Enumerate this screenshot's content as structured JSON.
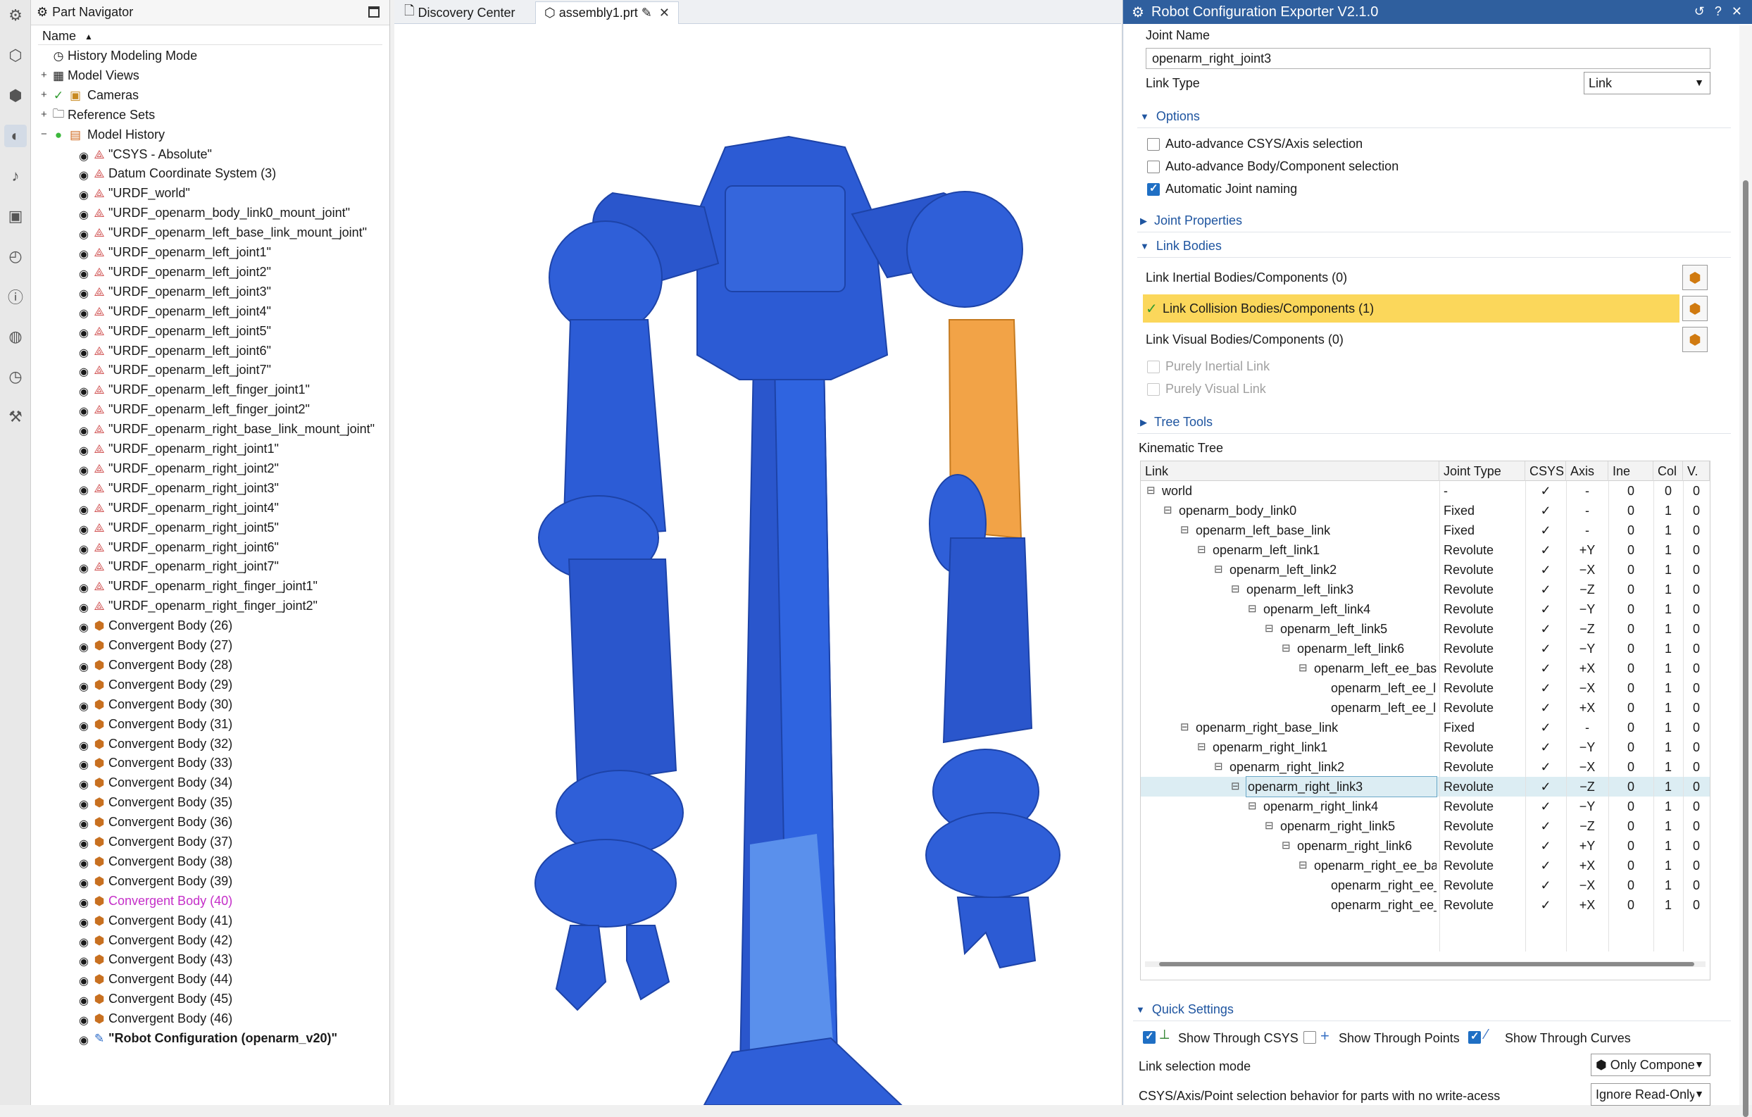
{
  "rail_icons": [
    "gear-icon",
    "part-icon",
    "assembly-icon",
    "navigator-icon",
    "bell-icon",
    "cube-icon",
    "history-icon",
    "info-icon",
    "globe-icon",
    "clock-icon",
    "tools-icon"
  ],
  "navigator": {
    "title": "Part Navigator",
    "column": "Name",
    "rows": [
      {
        "label": "History Modeling Mode",
        "icon": "clock-icon",
        "kind": "mode"
      },
      {
        "label": "Model Views",
        "icon": "views-icon",
        "kind": "folder"
      },
      {
        "label": "Cameras",
        "icon": "camera-icon",
        "kind": "folder"
      },
      {
        "label": "Reference Sets",
        "icon": "folder-icon",
        "kind": "folder"
      },
      {
        "label": "Model History",
        "icon": "history-icon",
        "kind": "folder"
      },
      {
        "label": "\"CSYS - Absolute\"",
        "kind": "csys"
      },
      {
        "label": "Datum Coordinate System (3)",
        "kind": "csys"
      },
      {
        "label": "\"URDF_world\"",
        "kind": "csys"
      },
      {
        "label": "\"URDF_openarm_body_link0_mount_joint\"",
        "kind": "csys"
      },
      {
        "label": "\"URDF_openarm_left_base_link_mount_joint\"",
        "kind": "csys"
      },
      {
        "label": "\"URDF_openarm_left_joint1\"",
        "kind": "csys"
      },
      {
        "label": "\"URDF_openarm_left_joint2\"",
        "kind": "csys"
      },
      {
        "label": "\"URDF_openarm_left_joint3\"",
        "kind": "csys"
      },
      {
        "label": "\"URDF_openarm_left_joint4\"",
        "kind": "csys"
      },
      {
        "label": "\"URDF_openarm_left_joint5\"",
        "kind": "csys"
      },
      {
        "label": "\"URDF_openarm_left_joint6\"",
        "kind": "csys"
      },
      {
        "label": "\"URDF_openarm_left_joint7\"",
        "kind": "csys"
      },
      {
        "label": "\"URDF_openarm_left_finger_joint1\"",
        "kind": "csys"
      },
      {
        "label": "\"URDF_openarm_left_finger_joint2\"",
        "kind": "csys"
      },
      {
        "label": "\"URDF_openarm_right_base_link_mount_joint\"",
        "kind": "csys"
      },
      {
        "label": "\"URDF_openarm_right_joint1\"",
        "kind": "csys"
      },
      {
        "label": "\"URDF_openarm_right_joint2\"",
        "kind": "csys"
      },
      {
        "label": "\"URDF_openarm_right_joint3\"",
        "kind": "csys"
      },
      {
        "label": "\"URDF_openarm_right_joint4\"",
        "kind": "csys"
      },
      {
        "label": "\"URDF_openarm_right_joint5\"",
        "kind": "csys"
      },
      {
        "label": "\"URDF_openarm_right_joint6\"",
        "kind": "csys"
      },
      {
        "label": "\"URDF_openarm_right_joint7\"",
        "kind": "csys"
      },
      {
        "label": "\"URDF_openarm_right_finger_joint1\"",
        "kind": "csys"
      },
      {
        "label": "\"URDF_openarm_right_finger_joint2\"",
        "kind": "csys"
      },
      {
        "label": "Convergent Body (26)",
        "kind": "body"
      },
      {
        "label": "Convergent Body (27)",
        "kind": "body"
      },
      {
        "label": "Convergent Body (28)",
        "kind": "body"
      },
      {
        "label": "Convergent Body (29)",
        "kind": "body"
      },
      {
        "label": "Convergent Body (30)",
        "kind": "body"
      },
      {
        "label": "Convergent Body (31)",
        "kind": "body"
      },
      {
        "label": "Convergent Body (32)",
        "kind": "body"
      },
      {
        "label": "Convergent Body (33)",
        "kind": "body"
      },
      {
        "label": "Convergent Body (34)",
        "kind": "body"
      },
      {
        "label": "Convergent Body (35)",
        "kind": "body"
      },
      {
        "label": "Convergent Body (36)",
        "kind": "body"
      },
      {
        "label": "Convergent Body (37)",
        "kind": "body"
      },
      {
        "label": "Convergent Body (38)",
        "kind": "body"
      },
      {
        "label": "Convergent Body (39)",
        "kind": "body"
      },
      {
        "label": "Convergent Body (40)",
        "kind": "body",
        "highlight": true
      },
      {
        "label": "Convergent Body (41)",
        "kind": "body"
      },
      {
        "label": "Convergent Body (42)",
        "kind": "body"
      },
      {
        "label": "Convergent Body (43)",
        "kind": "body"
      },
      {
        "label": "Convergent Body (44)",
        "kind": "body"
      },
      {
        "label": "Convergent Body (45)",
        "kind": "body"
      },
      {
        "label": "Convergent Body (46)",
        "kind": "body"
      },
      {
        "label": "\"Robot Configuration (openarm_v20)\"",
        "kind": "config",
        "bold": true
      }
    ]
  },
  "tabs": [
    {
      "label": "Discovery Center",
      "icon": "document-icon"
    },
    {
      "label": "assembly1.prt",
      "icon": "part-icon",
      "active": true
    }
  ],
  "colors": {
    "robot": "#2f5fd8",
    "robot_dark": "#1f45b0",
    "robot_light": "#4a7be8",
    "selected": "#f2a347",
    "title_bar": "#2f5f9e",
    "highlight_row": "#fbd75b"
  },
  "dialog": {
    "title": "Robot Configuration Exporter V2.1.0",
    "joint_name_label": "Joint Name",
    "joint_name_value": "openarm_right_joint3",
    "link_type_label": "Link Type",
    "link_type_value": "Link",
    "options_title": "Options",
    "options": [
      {
        "label": "Auto-advance CSYS/Axis selection",
        "checked": false
      },
      {
        "label": "Auto-advance Body/Component selection",
        "checked": false
      },
      {
        "label": "Automatic Joint naming",
        "checked": true
      }
    ],
    "joint_properties_title": "Joint Properties",
    "link_bodies_title": "Link Bodies",
    "inertial_label": "Link Inertial Bodies/Components (0)",
    "collision_label": "Link Collision Bodies/Components (1)",
    "visual_label": "Link Visual Bodies/Components (0)",
    "purely_inertial": "Purely Inertial Link",
    "purely_visual": "Purely Visual Link",
    "tree_tools_title": "Tree Tools",
    "kinematic_tree_label": "Kinematic Tree",
    "columns": [
      "Link",
      "Joint Type",
      "CSYS",
      "Axis",
      "Ine",
      "Col",
      "V."
    ],
    "rows": [
      {
        "name": "world",
        "depth": 0,
        "exp": true,
        "type": "-",
        "csys": "✓",
        "axis": "-",
        "ine": "0",
        "col": "0",
        "v": "0"
      },
      {
        "name": "openarm_body_link0",
        "depth": 1,
        "exp": true,
        "type": "Fixed",
        "csys": "✓",
        "axis": "-",
        "ine": "0",
        "col": "1",
        "v": "0"
      },
      {
        "name": "openarm_left_base_link",
        "depth": 2,
        "exp": true,
        "type": "Fixed",
        "csys": "✓",
        "axis": "-",
        "ine": "0",
        "col": "1",
        "v": "0"
      },
      {
        "name": "openarm_left_link1",
        "depth": 3,
        "exp": true,
        "type": "Revolute",
        "csys": "✓",
        "axis": "+Y",
        "ine": "0",
        "col": "1",
        "v": "0"
      },
      {
        "name": "openarm_left_link2",
        "depth": 4,
        "exp": true,
        "type": "Revolute",
        "csys": "✓",
        "axis": "−X",
        "ine": "0",
        "col": "1",
        "v": "0"
      },
      {
        "name": "openarm_left_link3",
        "depth": 5,
        "exp": true,
        "type": "Revolute",
        "csys": "✓",
        "axis": "−Z",
        "ine": "0",
        "col": "1",
        "v": "0"
      },
      {
        "name": "openarm_left_link4",
        "depth": 6,
        "exp": true,
        "type": "Revolute",
        "csys": "✓",
        "axis": "−Y",
        "ine": "0",
        "col": "1",
        "v": "0"
      },
      {
        "name": "openarm_left_link5",
        "depth": 7,
        "exp": true,
        "type": "Revolute",
        "csys": "✓",
        "axis": "−Z",
        "ine": "0",
        "col": "1",
        "v": "0"
      },
      {
        "name": "openarm_left_link6",
        "depth": 8,
        "exp": true,
        "type": "Revolute",
        "csys": "✓",
        "axis": "−Y",
        "ine": "0",
        "col": "1",
        "v": "0"
      },
      {
        "name": "openarm_left_ee_base_...",
        "depth": 9,
        "exp": true,
        "type": "Revolute",
        "csys": "✓",
        "axis": "+X",
        "ine": "0",
        "col": "1",
        "v": "0"
      },
      {
        "name": "openarm_left_ee_lin...",
        "depth": 10,
        "exp": false,
        "type": "Revolute",
        "csys": "✓",
        "axis": "−X",
        "ine": "0",
        "col": "1",
        "v": "0"
      },
      {
        "name": "openarm_left_ee_lin...",
        "depth": 10,
        "exp": false,
        "type": "Revolute",
        "csys": "✓",
        "axis": "+X",
        "ine": "0",
        "col": "1",
        "v": "0"
      },
      {
        "name": "openarm_right_base_link",
        "depth": 2,
        "exp": true,
        "type": "Fixed",
        "csys": "✓",
        "axis": "-",
        "ine": "0",
        "col": "1",
        "v": "0"
      },
      {
        "name": "openarm_right_link1",
        "depth": 3,
        "exp": true,
        "type": "Revolute",
        "csys": "✓",
        "axis": "−Y",
        "ine": "0",
        "col": "1",
        "v": "0"
      },
      {
        "name": "openarm_right_link2",
        "depth": 4,
        "exp": true,
        "type": "Revolute",
        "csys": "✓",
        "axis": "−X",
        "ine": "0",
        "col": "1",
        "v": "0"
      },
      {
        "name": "openarm_right_link3",
        "depth": 5,
        "exp": true,
        "type": "Revolute",
        "csys": "✓",
        "axis": "−Z",
        "ine": "0",
        "col": "1",
        "v": "0",
        "selected": true
      },
      {
        "name": "openarm_right_link4",
        "depth": 6,
        "exp": true,
        "type": "Revolute",
        "csys": "✓",
        "axis": "−Y",
        "ine": "0",
        "col": "1",
        "v": "0"
      },
      {
        "name": "openarm_right_link5",
        "depth": 7,
        "exp": true,
        "type": "Revolute",
        "csys": "✓",
        "axis": "−Z",
        "ine": "0",
        "col": "1",
        "v": "0"
      },
      {
        "name": "openarm_right_link6",
        "depth": 8,
        "exp": true,
        "type": "Revolute",
        "csys": "✓",
        "axis": "+Y",
        "ine": "0",
        "col": "1",
        "v": "0"
      },
      {
        "name": "openarm_right_ee_bas...",
        "depth": 9,
        "exp": true,
        "type": "Revolute",
        "csys": "✓",
        "axis": "+X",
        "ine": "0",
        "col": "1",
        "v": "0"
      },
      {
        "name": "openarm_right_ee_li...",
        "depth": 10,
        "exp": false,
        "type": "Revolute",
        "csys": "✓",
        "axis": "−X",
        "ine": "0",
        "col": "1",
        "v": "0"
      },
      {
        "name": "openarm_right_ee_li...",
        "depth": 10,
        "exp": false,
        "type": "Revolute",
        "csys": "✓",
        "axis": "+X",
        "ine": "0",
        "col": "1",
        "v": "0"
      }
    ],
    "quick_settings_title": "Quick Settings",
    "show_csys": "Show Through CSYS",
    "show_points": "Show Through Points",
    "show_curves": "Show Through Curves",
    "show_csys_checked": true,
    "show_points_checked": false,
    "show_curves_checked": true,
    "link_selection_label": "Link selection mode",
    "link_selection_value": "Only Compone",
    "csys_behavior_label": "CSYS/Axis/Point selection behavior for parts with no write-acess",
    "csys_behavior_value": "Ignore Read-Only"
  }
}
